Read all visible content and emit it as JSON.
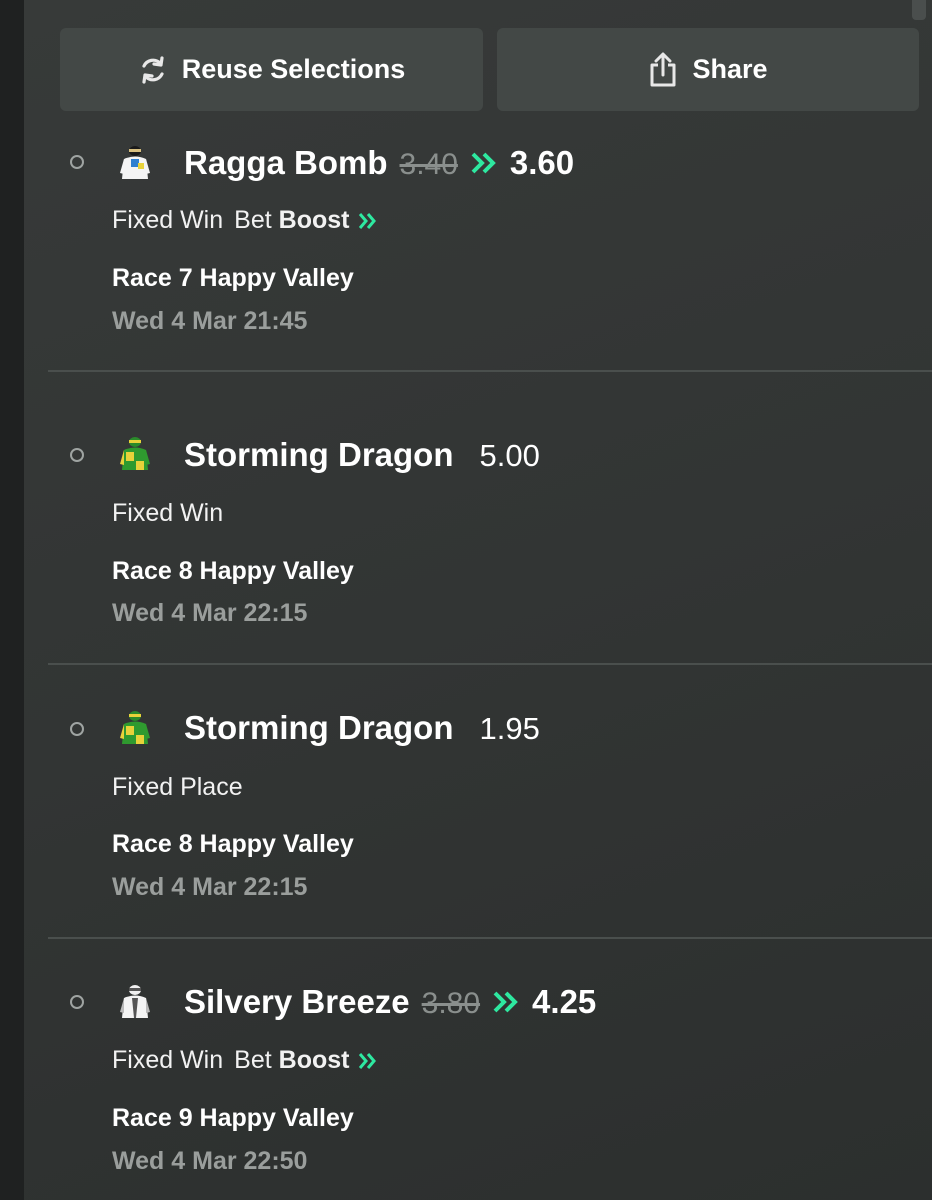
{
  "actions": {
    "reuse_label": "Reuse Selections",
    "share_label": "Share",
    "reuse_icon": "refresh-icon",
    "share_icon": "share-icon"
  },
  "colors": {
    "background": "#2e3130",
    "button_bg": "#434846",
    "boost_accent": "#2ee8a0",
    "muted_text": "#9a9e9c"
  },
  "selections": [
    {
      "runner": "Ragga Bomb",
      "old_odds": "3.40",
      "odds": "3.60",
      "boosted": true,
      "market": "Fixed Win",
      "bet_word": "Bet",
      "boost_word": "Boost",
      "race": "Race 7 Happy Valley",
      "time": "Wed 4 Mar 21:45",
      "silk_icon": "jockey-silk-white-blue-icon"
    },
    {
      "runner": "Storming Dragon",
      "odds": "5.00",
      "boosted": false,
      "market": "Fixed Win",
      "race": "Race 8 Happy Valley",
      "time": "Wed 4 Mar 22:15",
      "silk_icon": "jockey-silk-green-yellow-icon"
    },
    {
      "runner": "Storming Dragon",
      "odds": "1.95",
      "boosted": false,
      "market": "Fixed Place",
      "race": "Race 8 Happy Valley",
      "time": "Wed 4 Mar 22:15",
      "silk_icon": "jockey-silk-green-yellow-icon"
    },
    {
      "runner": "Silvery Breeze",
      "old_odds": "3.80",
      "odds": "4.25",
      "boosted": true,
      "market": "Fixed Win",
      "bet_word": "Bet",
      "boost_word": "Boost",
      "race": "Race 9 Happy Valley",
      "time": "Wed 4 Mar 22:50",
      "silk_icon": "jockey-silk-white-grey-icon"
    }
  ]
}
